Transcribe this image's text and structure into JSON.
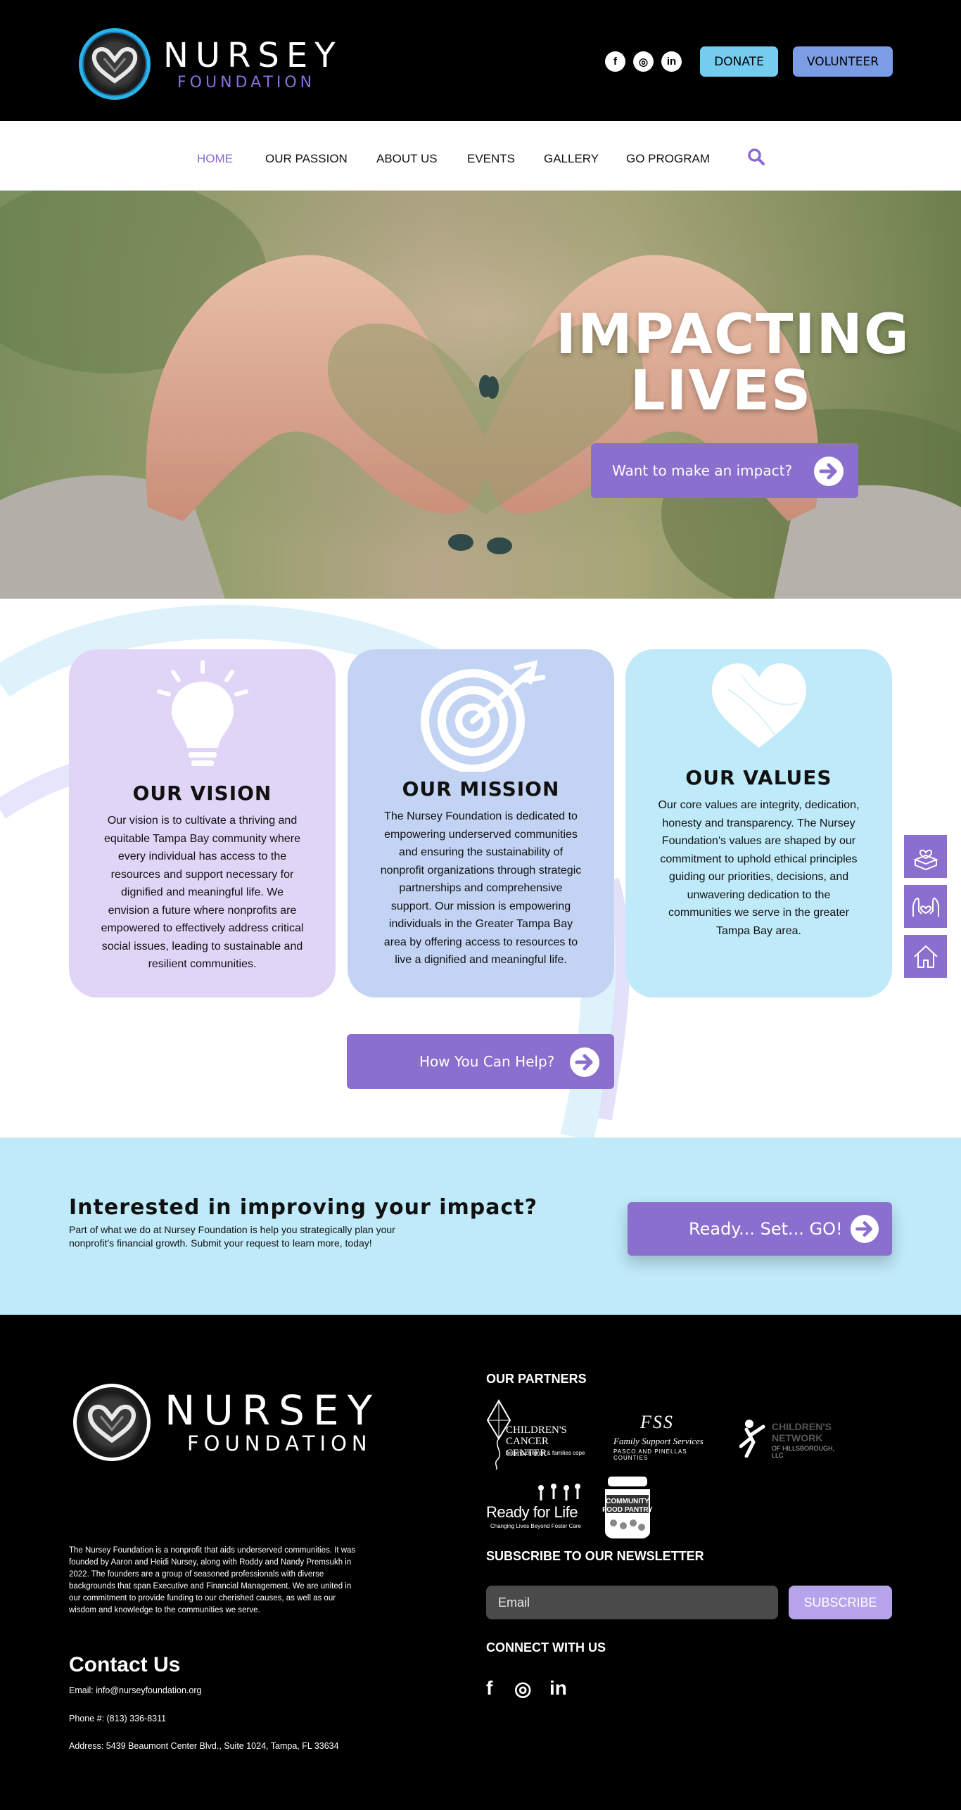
{
  "header": {
    "logo_name": "NURSEY",
    "logo_sub": "FOUNDATION",
    "social": [
      {
        "icon": "facebook-icon",
        "glyph": "f"
      },
      {
        "icon": "instagram-icon",
        "glyph": "◎"
      },
      {
        "icon": "linkedin-icon",
        "glyph": "in"
      }
    ],
    "donate_label": "DONATE",
    "volunteer_label": "VOLUNTEER"
  },
  "nav": {
    "items": [
      "HOME",
      "OUR PASSION",
      "ABOUT US",
      "EVENTS",
      "GALLERY",
      "GO PROGRAM"
    ],
    "active": "HOME"
  },
  "hero": {
    "title_line1": "IMPACTING",
    "title_line2": "LIVES",
    "cta_label": "Want to make an impact?"
  },
  "pillars": [
    {
      "title": "OUR VISION",
      "icon": "lightbulb-icon",
      "color": "#e1d5f7",
      "text": "Our vision is to cultivate a thriving and equitable Tampa Bay community where every individual has access to the resources and support necessary for dignified and meaningful life. We envision a future where nonprofits are empowered to effectively address critical social issues, leading to sustainable and resilient communities."
    },
    {
      "title": "OUR MISSION",
      "icon": "target-icon",
      "color": "#c3d3f3",
      "text": "The Nursey Foundation is dedicated to empowering underserved communities and ensuring the sustainability of nonprofit organizations through strategic partnerships and comprehensive support. Our mission is empowering individuals in the Greater Tampa Bay area by offering access to resources to live a dignified and meaningful life."
    },
    {
      "title": "OUR VALUES",
      "icon": "heart-icon",
      "color": "#bfeaf9",
      "text": "Our core values are integrity, dedication, honesty and transparency. The Nursey Foundation's values are shaped by our commitment to uphold ethical principles guiding our priorities, decisions, and unwavering dedication to the communities we serve in the greater Tampa Bay area."
    }
  ],
  "help_label": "How You Can Help?",
  "side_icons": [
    "donation-box-icon",
    "helping-hands-icon",
    "home-icon"
  ],
  "impact": {
    "title": "Interested in improving your impact?",
    "text": "Part of what we do at Nursey Foundation is help you strategically plan your nonprofit's financial growth. Submit your request to learn more, today!",
    "cta_label": "Ready... Set... GO!"
  },
  "footer": {
    "logo_name": "NURSEY",
    "logo_sub": "FOUNDATION",
    "about": "The Nursey Foundation is a nonprofit that aids underserved communities. It was founded by Aaron and Heidi Nursey, along with Roddy and Nandy Premsukh in 2022. The founders are a group of seasoned professionals with diverse backgrounds that span Executive and Financial Management. We are united in our commitment to provide funding to our cherished causes, as well as our wisdom and knowledge to the communities we serve.",
    "contact_title": "Contact Us",
    "email_line": "Email: info@nurseyfoundation.org",
    "phone_line": "Phone #: (813) 336-8311",
    "address_line": "Address: 5439 Beaumont Center Blvd., Suite 1024, Tampa, FL 33634",
    "partners_title": "OUR PARTNERS",
    "partners": {
      "p1_a": "CHILDREN'S",
      "p1_b": "CANCER CENTER",
      "p1_c": "helping children & families cope",
      "p2_a": "FSS",
      "p2_b": "Family Support Services",
      "p2_c": "PASCO AND PINELLAS COUNTIES",
      "p3_a": "CHILDREN'S",
      "p3_b": "NETWORK",
      "p3_c": "OF HILLSBOROUGH, LLC",
      "p4_a": "Ready for Life",
      "p4_b": "Changing Lives Beyond Foster Care",
      "p5_a": "COMMUNITY",
      "p5_b": "FOOD PANTRY"
    },
    "newsletter_title": "SUBSCRIBE TO OUR NEWSLETTER",
    "email_placeholder": "Email",
    "subscribe_label": "SUBSCRIBE",
    "connect_title": "CONNECT WITH US",
    "connect": [
      "f",
      "◎",
      "in"
    ]
  }
}
